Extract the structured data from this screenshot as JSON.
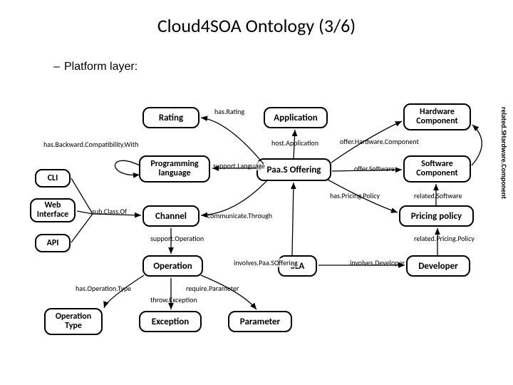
{
  "title": "Cloud4SOA Ontology (3/6)",
  "subtitle": "Platform layer:",
  "dash": "–",
  "nodes": {
    "rating": "Rating",
    "application": "Application",
    "hardware_component": "Hardware Component",
    "programming_language": "Programming language",
    "paas_offering": "Paa.S Offering",
    "software_component": "Software Component",
    "cli": "CLI",
    "web_interface": "Web Interface",
    "api": "API",
    "channel": "Channel",
    "pricing_policy": "Pricing policy",
    "operation": "Operation",
    "sla": "SLA",
    "developer": "Developer",
    "operation_type": "Operation Type",
    "exception": "Exception",
    "parameter": "Parameter"
  },
  "edges": {
    "has_rating": "has.Rating",
    "has_backward_compat": "has.Backward.Compatibility.With",
    "support_language": "support.Language",
    "host_application": "host.Application",
    "offer_hardware": "offer.Hardware.Component",
    "offer_software": "offer.Software",
    "sub_class_of": "sub.Class.Of",
    "communicate_through": "communicate.Through",
    "has_pricing_policy": "has.Pricing.Policy",
    "related_software": "related.Software",
    "support_operation": "support.Operation",
    "involves_paas": "involves.Paa.SOffering",
    "related_pricing": "related.Pricing.Policy",
    "has_operation_type": "has.Operation.Type",
    "require_parameter": "require.Parameter",
    "throw_exception": "throw.Exception",
    "involves_developer": "involves.Developer"
  },
  "side_label": "related.SHardware.Component"
}
